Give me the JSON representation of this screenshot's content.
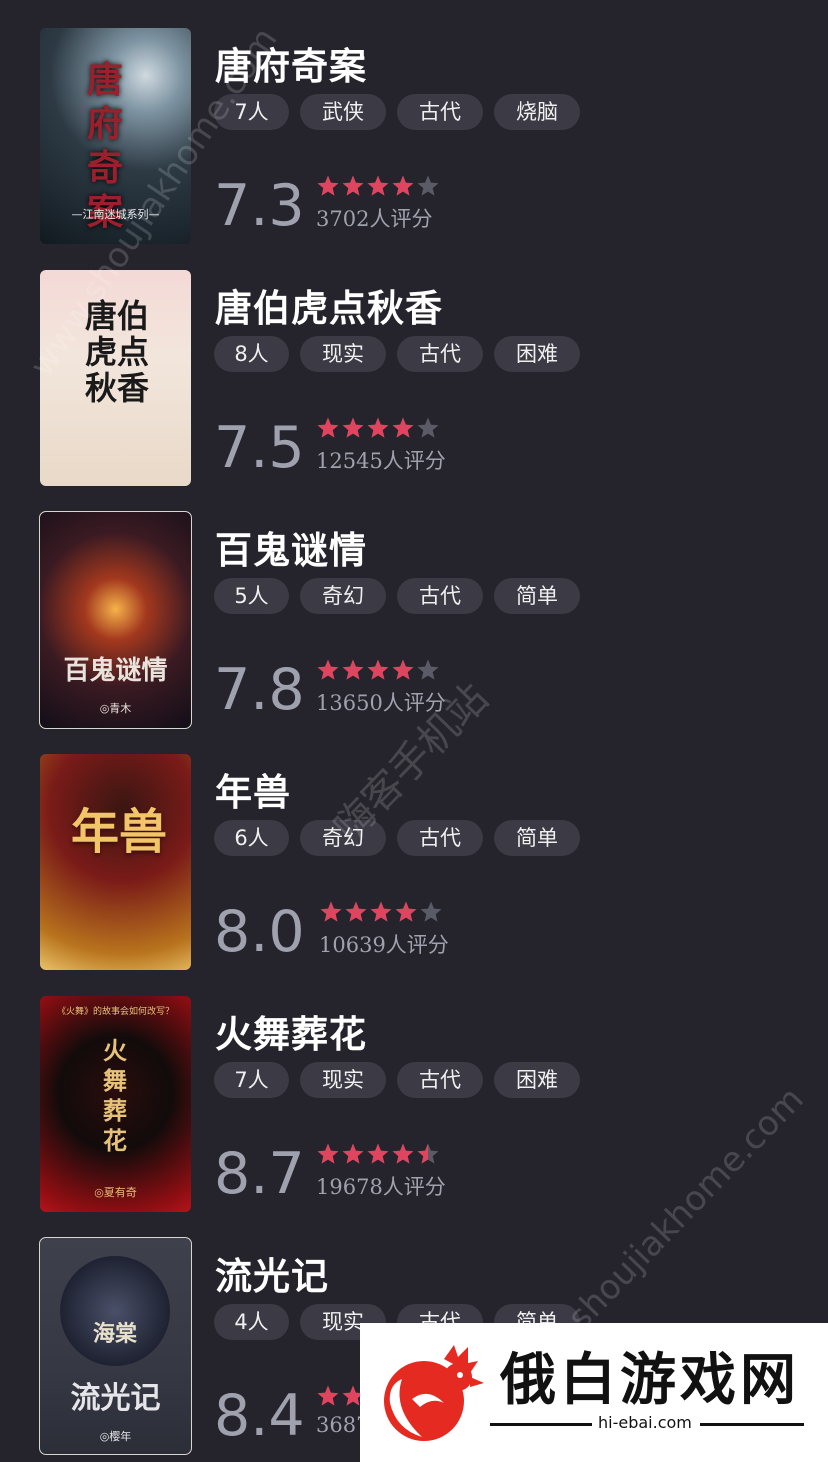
{
  "games": [
    {
      "title": "唐府奇案",
      "tags": [
        "7人",
        "武侠",
        "古代",
        "烧脑"
      ],
      "score": "7.3",
      "rating": 4,
      "rating_count": "3702人评分",
      "cover": {
        "title": "唐府奇案",
        "subtitle": "—江南迷城系列—",
        "bg": "#2d3a44",
        "accent": "#9b1f2c"
      }
    },
    {
      "title": "唐伯虎点秋香",
      "tags": [
        "8人",
        "现实",
        "古代",
        "困难"
      ],
      "score": "7.5",
      "rating": 4,
      "rating_count": "12545人评分",
      "cover": {
        "title": "唐伯虎点秋香",
        "subtitle": "",
        "bg": "#efe3d6",
        "accent": "#1a1a1a"
      }
    },
    {
      "title": "百鬼谜情",
      "tags": [
        "5人",
        "奇幻",
        "古代",
        "简单"
      ],
      "score": "7.8",
      "rating": 4,
      "rating_count": "13650人评分",
      "cover": {
        "title": "百鬼谜情",
        "subtitle": "◎青木",
        "bg": "#1b1420",
        "accent": "#e9e3dc"
      }
    },
    {
      "title": "年兽",
      "tags": [
        "6人",
        "奇幻",
        "古代",
        "简单"
      ],
      "score": "8.0",
      "rating": 4,
      "rating_count": "10639人评分",
      "cover": {
        "title": "年兽",
        "subtitle": "",
        "bg": "#7a1b18",
        "accent": "#f2c56b"
      }
    },
    {
      "title": "火舞葬花",
      "tags": [
        "7人",
        "现实",
        "古代",
        "困难"
      ],
      "score": "8.7",
      "rating": 4.5,
      "rating_count": "19678人评分",
      "cover": {
        "title": "火舞葬花",
        "subtitle": "◎夏有奇",
        "bg": "#120b0b",
        "accent": "#e7c27a",
        "top_line": "《火舞》的故事会如何改写？"
      }
    },
    {
      "title": "流光记",
      "tags": [
        "4人",
        "现实",
        "古代",
        "简单"
      ],
      "score": "8.4",
      "rating": 4,
      "rating_count": "3687",
      "cover": {
        "title": "流光记",
        "subtitle": "◎樱年",
        "bg": "#363844",
        "accent": "#e6e6ea",
        "logo": "海棠"
      }
    }
  ],
  "watermarks": [
    "www.shoujiakhome.com",
    "嗨客手机站",
    "shoujiakhome.com"
  ],
  "brand": {
    "name": "俄白游戏网",
    "url": "hi-ebai.com"
  },
  "colors": {
    "background": "#25242c",
    "star_active": "#e0455f",
    "star_inactive": "#5a5b66",
    "muted_text": "#9fa1ae",
    "tag_bg": "#3b3a45"
  }
}
